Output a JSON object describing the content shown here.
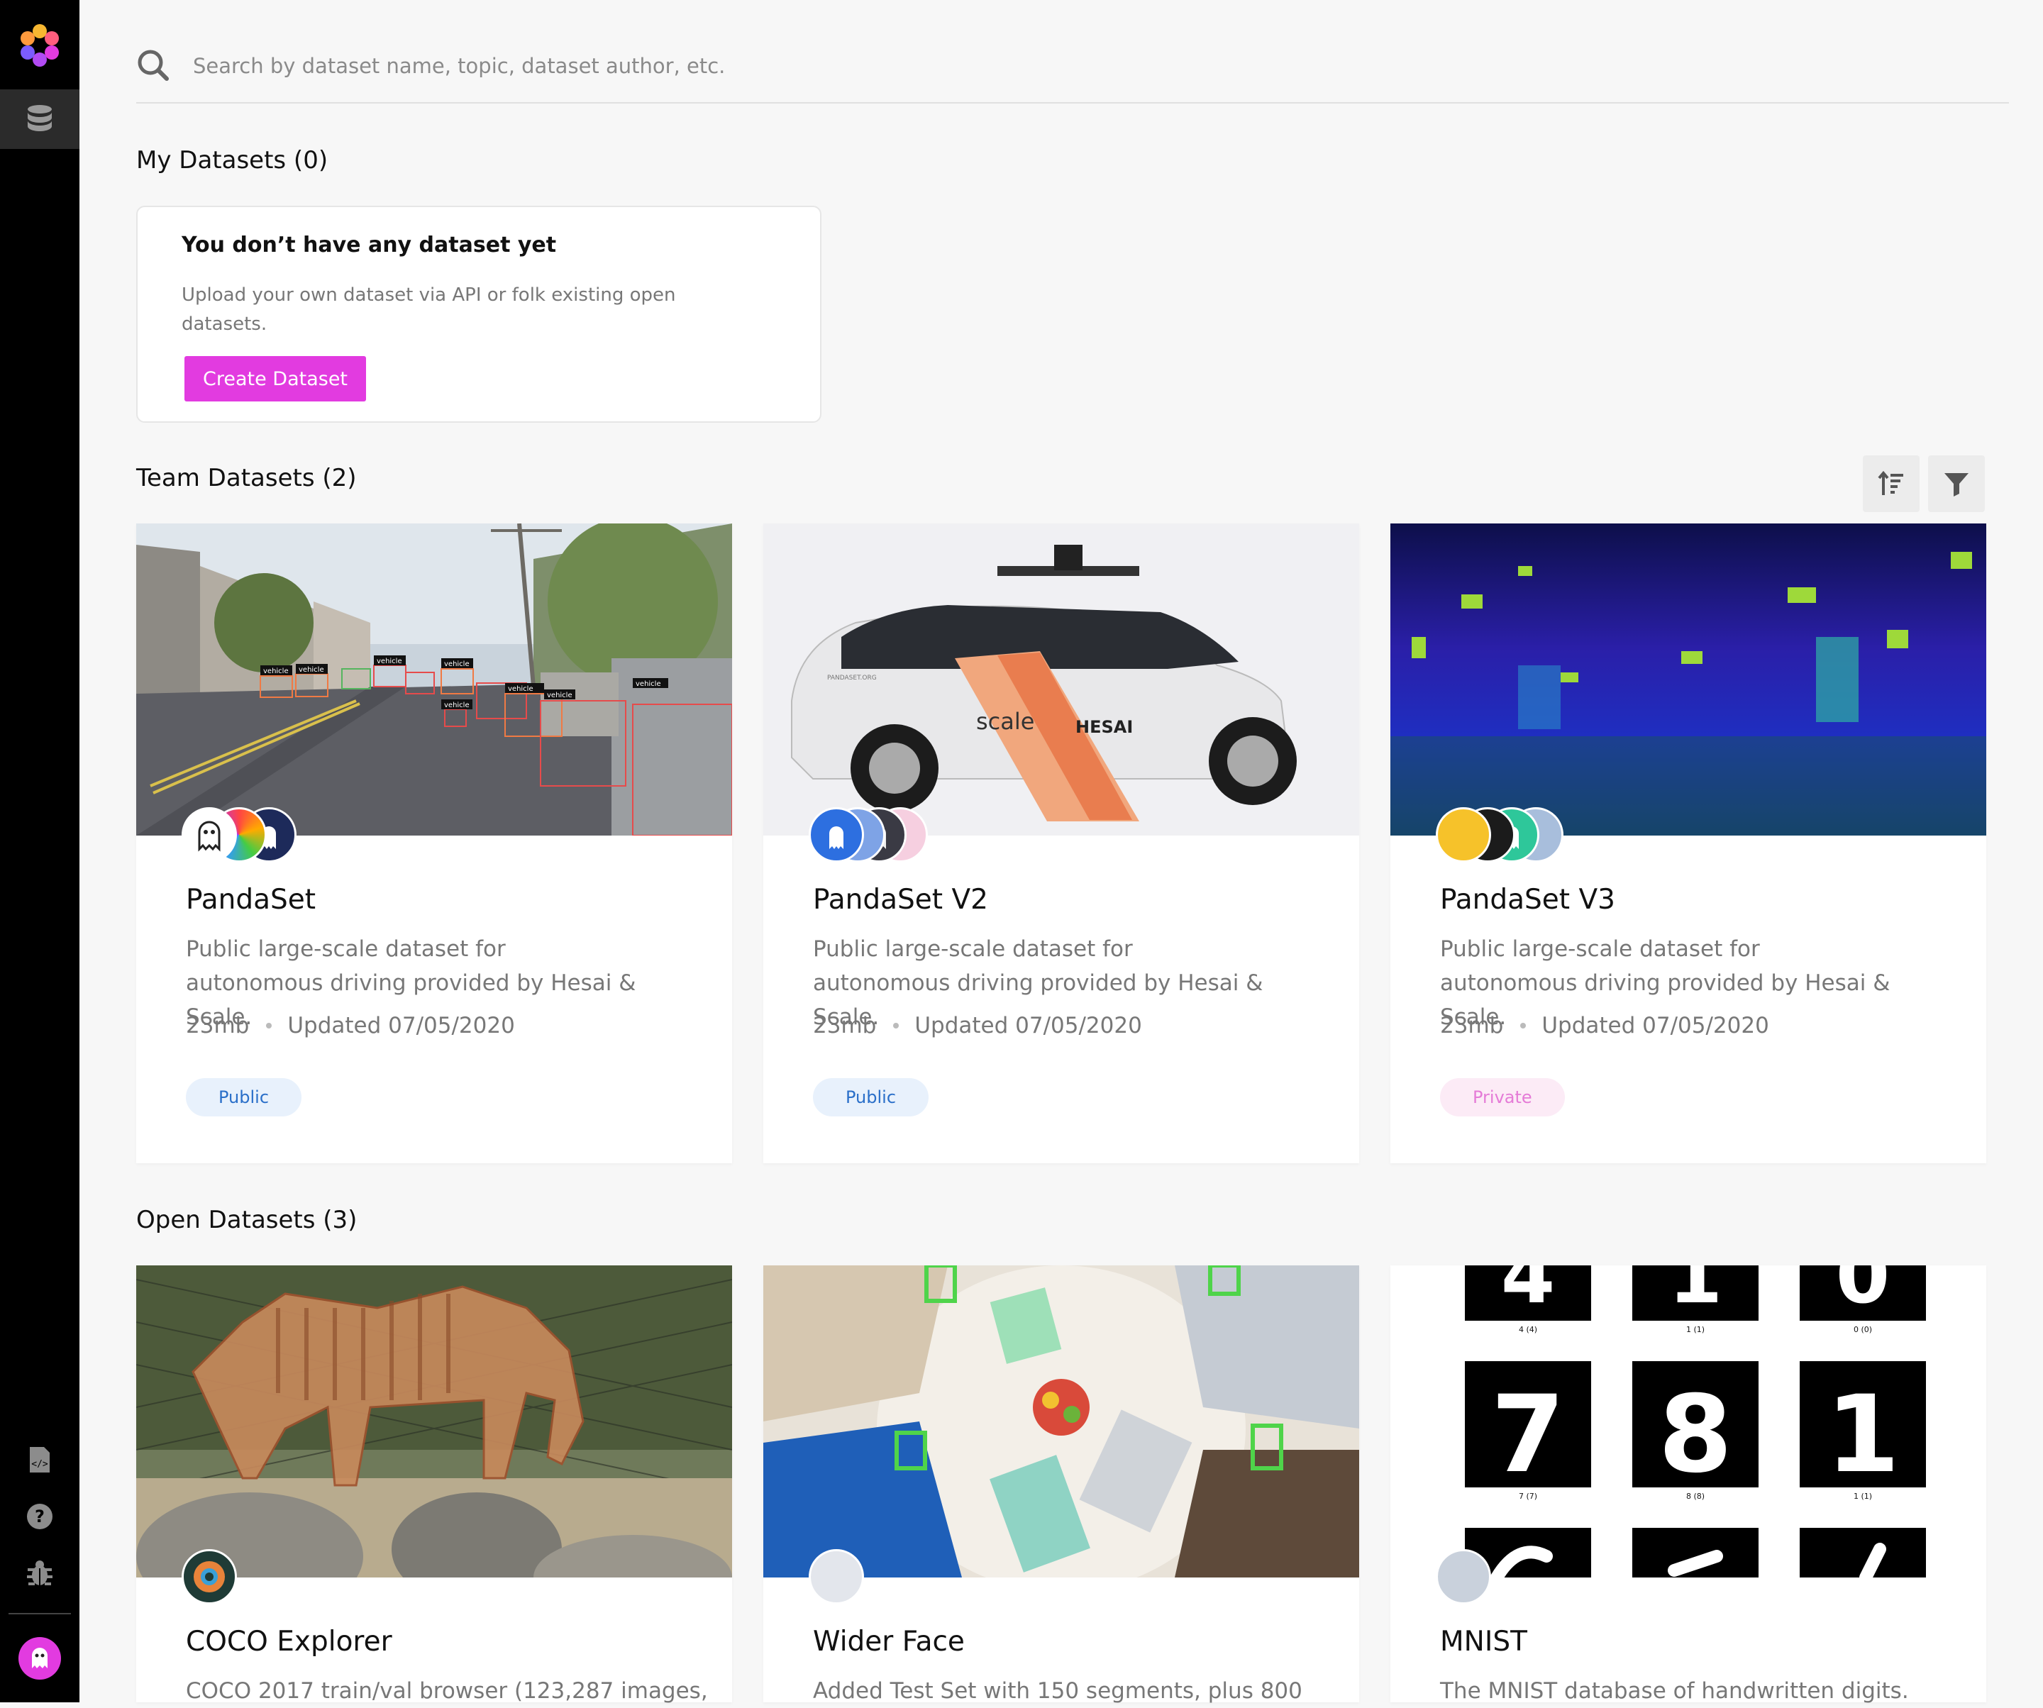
{
  "search": {
    "placeholder": "Search by dataset name, topic, dataset author, etc."
  },
  "sections": {
    "my": {
      "title": "My Datasets (0)"
    },
    "team": {
      "title": "Team Datasets (2)"
    },
    "open": {
      "title": "Open Datasets (3)"
    }
  },
  "empty_state": {
    "title": "You don’t have any dataset yet",
    "body": "Upload your own dataset via API or folk existing open datasets.",
    "button": "Create Dataset"
  },
  "team_datasets": [
    {
      "name": "PandaSet",
      "description": "Public large-scale dataset for autonomous driving provided by Hesai & Scale.",
      "size": "23mb",
      "updated": "Updated 07/05/2020",
      "visibility": "Public"
    },
    {
      "name": "PandaSet V2",
      "description": "Public large-scale dataset for autonomous driving provided by Hesai & Scale.",
      "size": "23mb",
      "updated": "Updated 07/05/2020",
      "visibility": "Public"
    },
    {
      "name": "PandaSet V3",
      "description": "Public large-scale dataset for autonomous driving provided by Hesai & Scale.",
      "size": "23mb",
      "updated": "Updated 07/05/2020",
      "visibility": "Private"
    }
  ],
  "open_datasets": [
    {
      "name": "COCO Explorer",
      "description": "COCO 2017 train/val browser (123,287 images,"
    },
    {
      "name": "Wider Face",
      "description": "Added Test Set with 150 segments, plus 800"
    },
    {
      "name": "MNIST",
      "description": "The MNIST database of handwritten digits."
    }
  ],
  "image_text": {
    "vehicle_label": "vehicle",
    "car_brand": "scale",
    "car_partner": "HESAI",
    "car_url": "PANDASET.ORG",
    "mnist_digits": [
      "4",
      "1",
      "0",
      "7",
      "8",
      "1"
    ],
    "mnist_labels": [
      "4 (4)",
      "1 (1)",
      "0 (0)",
      "7 (7)",
      "8 (8)",
      "1 (1)"
    ]
  },
  "colors": {
    "accent": "#e23be0",
    "sidebar": "#000000",
    "public_badge": "#2a6fc9",
    "private_badge": "#e57bd7"
  },
  "icons": {
    "sidebar_top": [
      "logo-icon",
      "database-icon"
    ],
    "sidebar_bottom": [
      "api-docs-icon",
      "help-icon",
      "bug-report-icon",
      "user-avatar"
    ],
    "toolbar": [
      "sort-icon",
      "filter-icon"
    ]
  }
}
